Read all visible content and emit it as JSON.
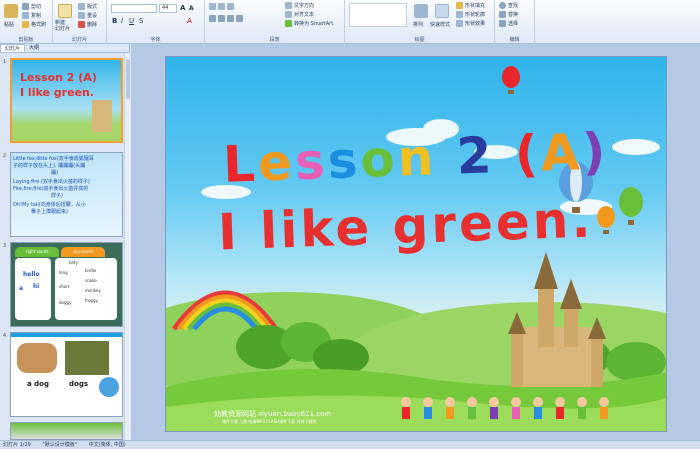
{
  "ribbon": {
    "clipboard": {
      "paste": "粘贴",
      "cut": "剪切",
      "copy": "复制",
      "format_painter": "格式刷",
      "label": "剪贴板"
    },
    "slides": {
      "new_slide": "新建\n幻灯片",
      "layout": "版式",
      "reset": "重设",
      "delete": "删除",
      "label": "幻灯片"
    },
    "font": {
      "size": "44",
      "label": "字体"
    },
    "paragraph": {
      "text_direction": "文字方向",
      "align_text": "对齐文本",
      "smartart": "转换为 SmartArt",
      "label": "段落"
    },
    "drawing": {
      "arrange": "排列",
      "quick_styles": "快速样式",
      "shape_fill": "形状填充",
      "shape_outline": "形状轮廓",
      "shape_effects": "形状效果",
      "label": "绘图"
    },
    "editing": {
      "find": "查找",
      "replace": "替换",
      "select": "选择",
      "label": "编辑"
    }
  },
  "panel": {
    "tabs": [
      "幻灯片",
      "大纲"
    ],
    "slides": [
      {
        "num": "1",
        "line1": "Lesson 2 (A)",
        "line2": "I like green."
      },
      {
        "num": "2",
        "lines": [
          "Little fox,little fox(双手食成狐狸耳",
          "子的样子放在头上), 蹦蹦蹦(头蹦",
          "蹦)",
          "Laying fire (双手食出火苗的样子)",
          "Fire,fire,fire(双手食出火苗并高的",
          "样子)",
          "Oh!My tail(向身体后扭腰，从小",
          "稚子上摸跟起来)"
        ]
      },
      {
        "num": "3",
        "tab1": "sight words",
        "tab2": "say words",
        "left_words": [
          "hello",
          "a",
          "hi"
        ],
        "right_words": [
          "kitty",
          "long",
          "birdie",
          "snake",
          "short",
          "monkey",
          "doggy",
          "froggy"
        ]
      },
      {
        "num": "4",
        "word1": "a dog",
        "word2": "dogs"
      }
    ]
  },
  "slide": {
    "title_line1": "Lesson 2 (A)",
    "title_line2": "I like green.",
    "watermark": "幼教资源网站  ziyuan.baby611.com",
    "watermark_sub": "课件下载 儿歌 故事MP3 FLASH课件下载 试卷下载等"
  },
  "colors": {
    "title_line1": [
      "#e8262c",
      "#f29a1f",
      "#e85fb5",
      "#1c8ee0",
      "#6abf3a",
      "#f0c020",
      "#2a3b9e",
      "#e8262c",
      "#f29a1f",
      "#7e3fb0",
      "#2a8ee0"
    ],
    "title_line2": "#e83030"
  },
  "statusbar": {
    "slide_info": "幻灯片 1/29",
    "theme": "\"默认设计模板\"",
    "language": "中文(简体, 中国)"
  }
}
